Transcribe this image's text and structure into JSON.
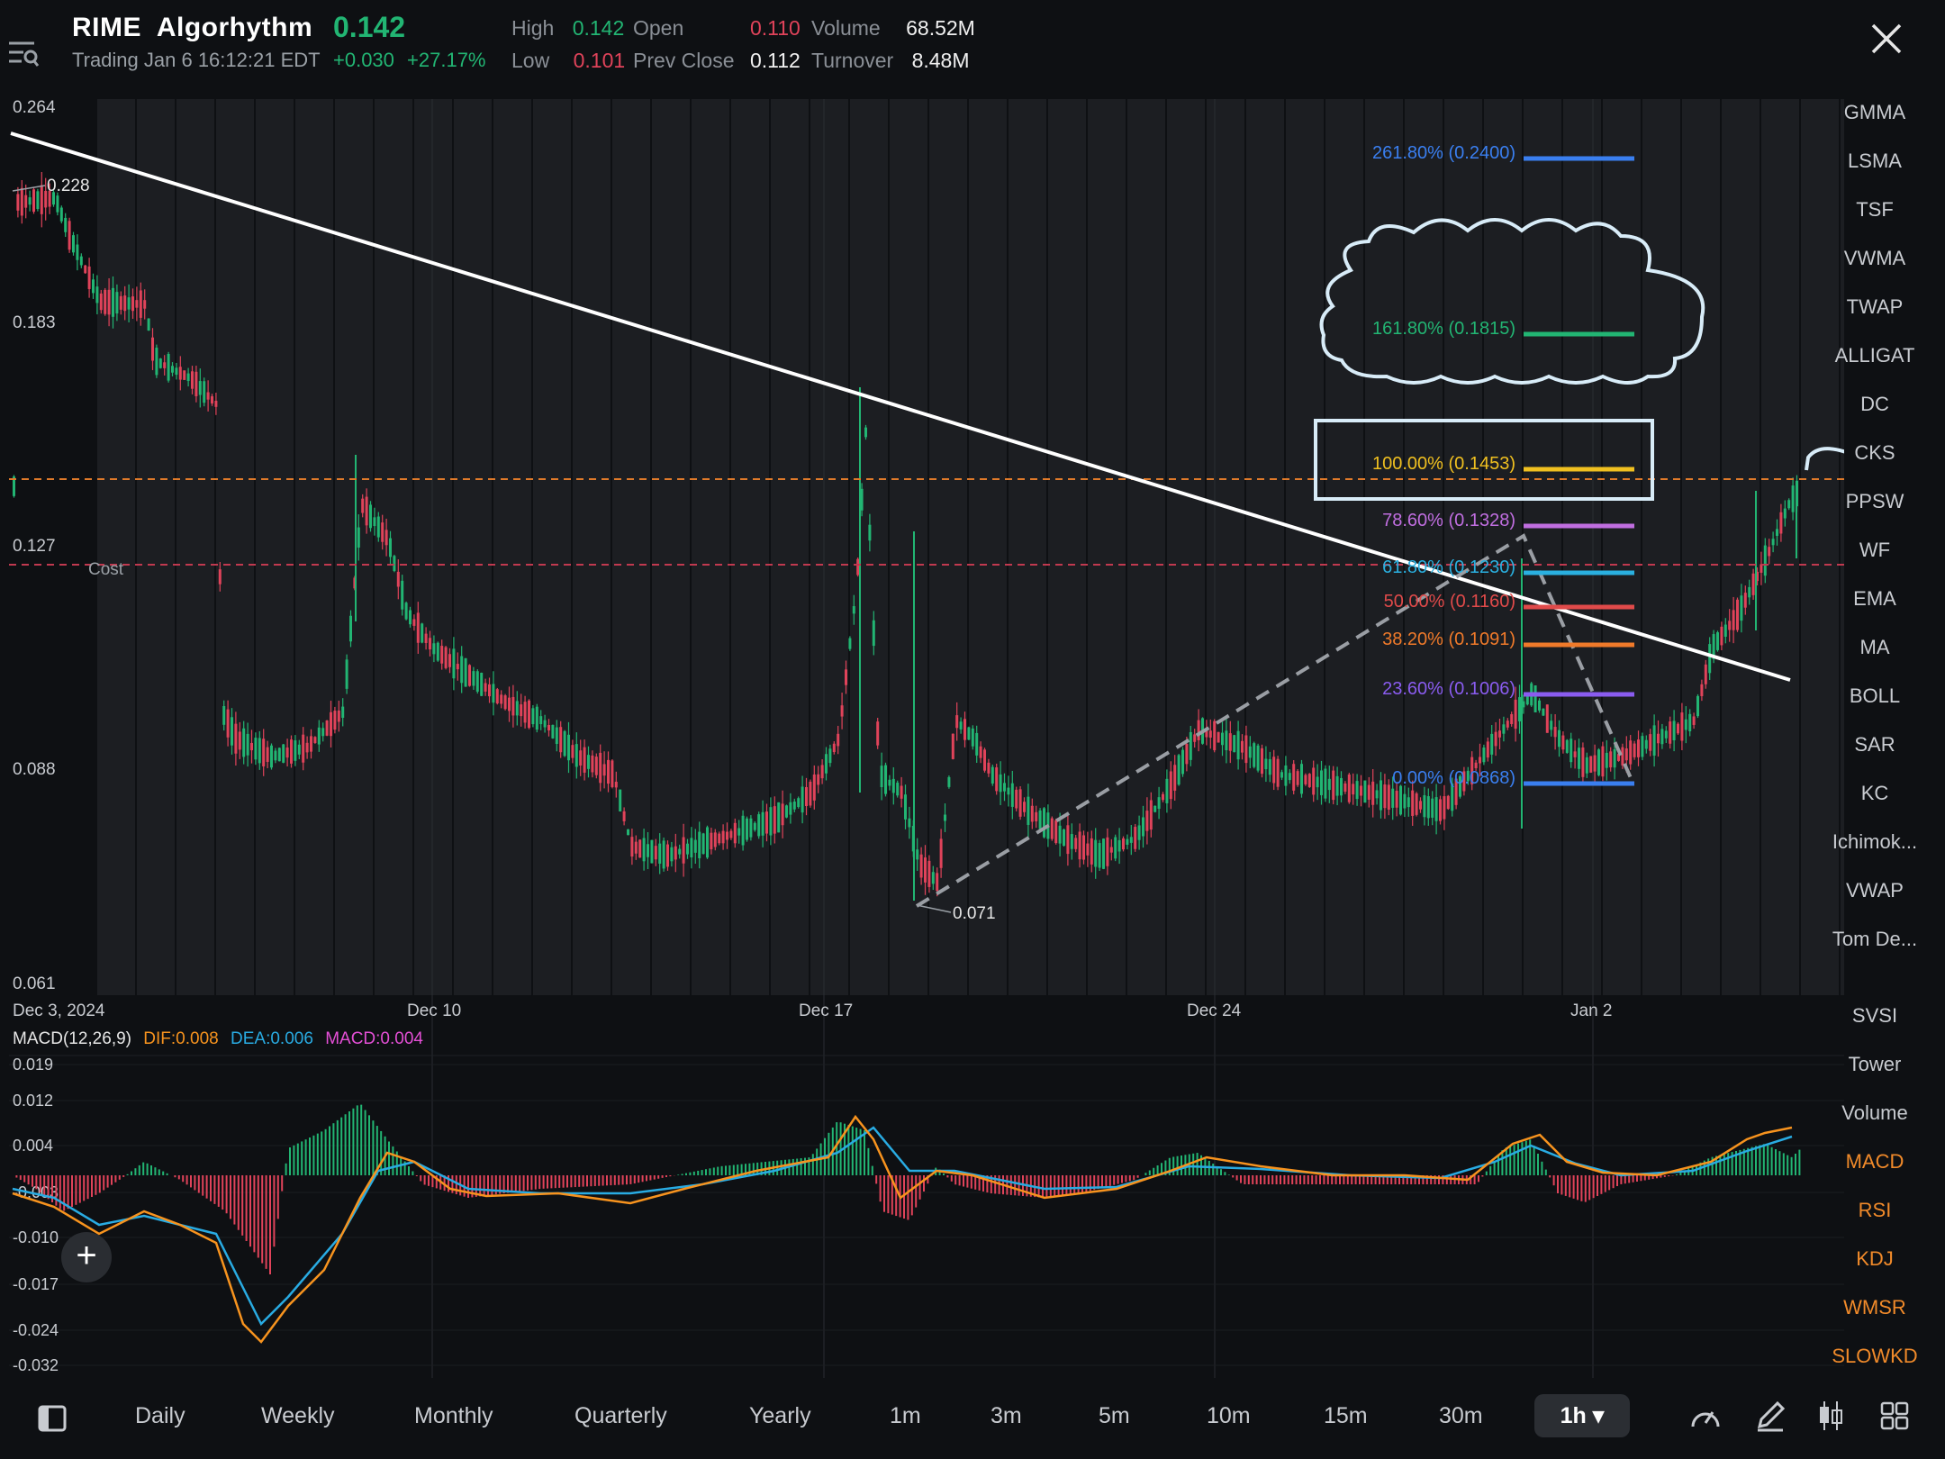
{
  "header": {
    "symbol": "RIME",
    "name": "Algorhythm",
    "status": "Trading Jan 6 16:12:21 EDT",
    "price": "0.142",
    "change": "+0.030",
    "change_pct": "+27.17%",
    "stats": {
      "high_label": "High",
      "high": "0.142",
      "low_label": "Low",
      "low": "0.101",
      "open_label": "Open",
      "open": "0.110",
      "prev_close_label": "Prev Close",
      "prev_close": "0.112",
      "volume_label": "Volume",
      "volume": "68.52M",
      "turnover_label": "Turnover",
      "turnover": "8.48M"
    }
  },
  "price_axis": {
    "ticks": [
      "0.264",
      "0.183",
      "0.127",
      "0.088",
      "0.061"
    ],
    "high_marker": "0.228",
    "low_marker": "0.071",
    "cost_label": "Cost"
  },
  "date_axis": [
    "Dec 3, 2024",
    "Dec 10",
    "Dec 17",
    "Dec 24",
    "Jan 2"
  ],
  "fibonacci": [
    {
      "label": "261.80% (0.2400)",
      "color": "#3a7ff0"
    },
    {
      "label": "161.80% (0.1815)",
      "color": "#22b573"
    },
    {
      "label": "100.00% (0.1453)",
      "color": "#f0c020"
    },
    {
      "label": "78.60% (0.1328)",
      "color": "#c06ee0"
    },
    {
      "label": "61.80% (0.1230)",
      "color": "#2ab0e0"
    },
    {
      "label": "50.00% (0.1160)",
      "color": "#e04a4a"
    },
    {
      "label": "38.20% (0.1091)",
      "color": "#f07a2a"
    },
    {
      "label": "23.60% (0.1006)",
      "color": "#8a5cf0"
    },
    {
      "label": "0.00% (0.0868)",
      "color": "#3a7ff0"
    }
  ],
  "macd": {
    "title": "MACD(12,26,9)",
    "dif": "DIF:0.008",
    "dea": "DEA:0.006",
    "macd": "MACD:0.004",
    "ticks": [
      "0.019",
      "0.012",
      "0.004",
      "-0.003",
      "-0.010",
      "-0.017",
      "-0.024",
      "-0.032"
    ]
  },
  "sidebar_overlays": [
    "GMMA",
    "LSMA",
    "TSF",
    "VWMA",
    "TWAP",
    "ALLIGAT",
    "DC",
    "CKS",
    "PPSW",
    "WF",
    "EMA",
    "MA",
    "BOLL",
    "SAR",
    "KC",
    "Ichimok...",
    "VWAP",
    "Tom De..."
  ],
  "sidebar_indicators": [
    "SVSI",
    "Tower",
    "Volume",
    "MACD",
    "RSI",
    "KDJ",
    "WMSR",
    "SLOWKD"
  ],
  "timeframes": [
    "Daily",
    "Weekly",
    "Monthly",
    "Quarterly",
    "Yearly",
    "1m",
    "3m",
    "5m",
    "10m",
    "15m",
    "30m"
  ],
  "active_timeframe": "1h ▾",
  "colors": {
    "up": "#22b573",
    "down": "#e0435a",
    "dif": "#f7931e",
    "dea": "#29abe2",
    "macd": "#e44fd6"
  }
}
